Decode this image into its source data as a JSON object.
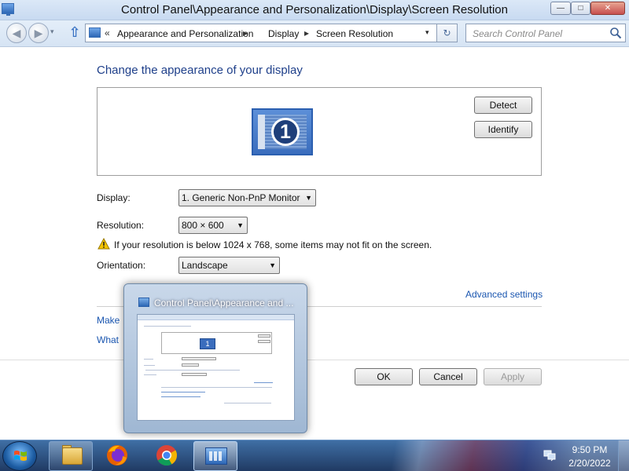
{
  "window": {
    "title": "Control Panel\\Appearance and Personalization\\Display\\Screen Resolution",
    "min_glyph": "—",
    "max_glyph": "□",
    "close_glyph": "✕"
  },
  "nav": {
    "back_glyph": "◀",
    "forward_glyph": "▶",
    "recent_glyph": "▾",
    "up_glyph": "⇧",
    "chevron": "«",
    "separator": "▸",
    "breadcrumbs": [
      "Appearance and Personalization",
      "Display",
      "Screen Resolution"
    ],
    "address_drop_glyph": "▾",
    "refresh_glyph": "↻",
    "search_placeholder": "Search Control Panel"
  },
  "content": {
    "heading": "Change the appearance of your display",
    "monitor_number": "1",
    "detect_label": "Detect",
    "identify_label": "Identify",
    "display_label": "Display:",
    "display_value": "1. Generic Non-PnP Monitor",
    "resolution_label": "Resolution:",
    "resolution_value": "800 × 600",
    "warning_text": "If your resolution is below 1024 x 768, some items may not fit on the screen.",
    "orientation_label": "Orientation:",
    "orientation_value": "Landscape",
    "dropdown_glyph": "▼",
    "advanced_link": "Advanced settings",
    "link_make": "Make",
    "link_what": "What"
  },
  "buttons": {
    "ok": "OK",
    "cancel": "Cancel",
    "apply": "Apply"
  },
  "thumbnail": {
    "title": "Control Panel\\Appearance and ...",
    "mini_monitor_number": "1"
  },
  "taskbar": {
    "time": "9:50 PM",
    "date": "2/20/2022"
  },
  "colors": {
    "heading": "#1e3f8a",
    "link": "#1a56b0",
    "taskbar": "#203a63",
    "warning": "#f5c400"
  }
}
